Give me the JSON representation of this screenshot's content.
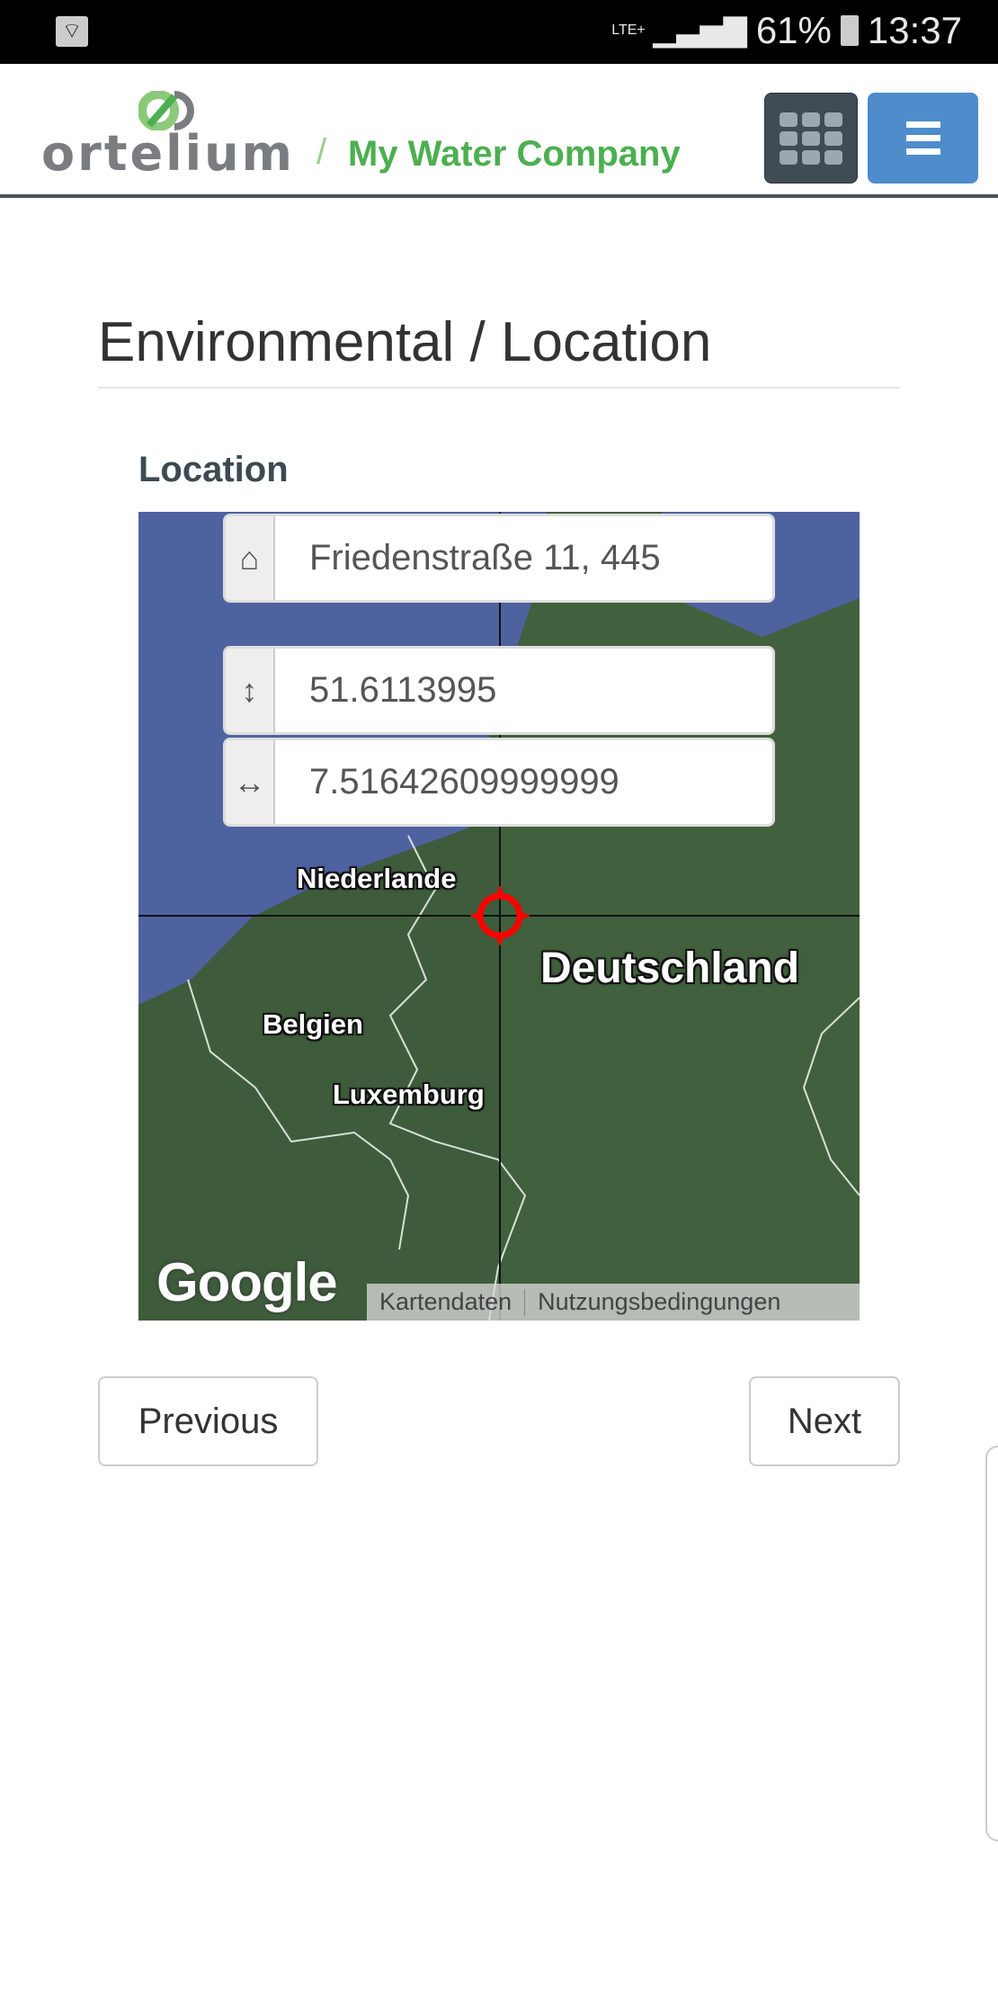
{
  "status_bar": {
    "network": "LTE+",
    "battery": "61%",
    "time": "13:37",
    "icons": [
      "wifi-icon",
      "signal-icon",
      "battery-charging-icon"
    ]
  },
  "header": {
    "logo_text": "ortelium",
    "separator": "/",
    "company": "My Water Company",
    "apps_button_icon": "grid-icon",
    "menu_button_icon": "hamburger-icon"
  },
  "page": {
    "title": "Environmental / Location",
    "section_label": "Location"
  },
  "map": {
    "address": "Friedenstraße 11, 445",
    "latitude": "51.6113995",
    "longitude": "7.51642609999999",
    "labels": {
      "nl": "Niederlande",
      "de": "Deutschland",
      "be": "Belgien",
      "lu": "Luxemburg"
    },
    "provider_logo": "Google",
    "attribution": [
      "Kartendaten",
      "Nutzungsbedingungen"
    ],
    "marker_color": "#ff0000"
  },
  "nav": {
    "previous": "Previous",
    "next": "Next"
  },
  "colors": {
    "brand_green": "#4caf50",
    "menu_blue": "#4e8ccc",
    "apps_dark": "#3f4c55"
  }
}
